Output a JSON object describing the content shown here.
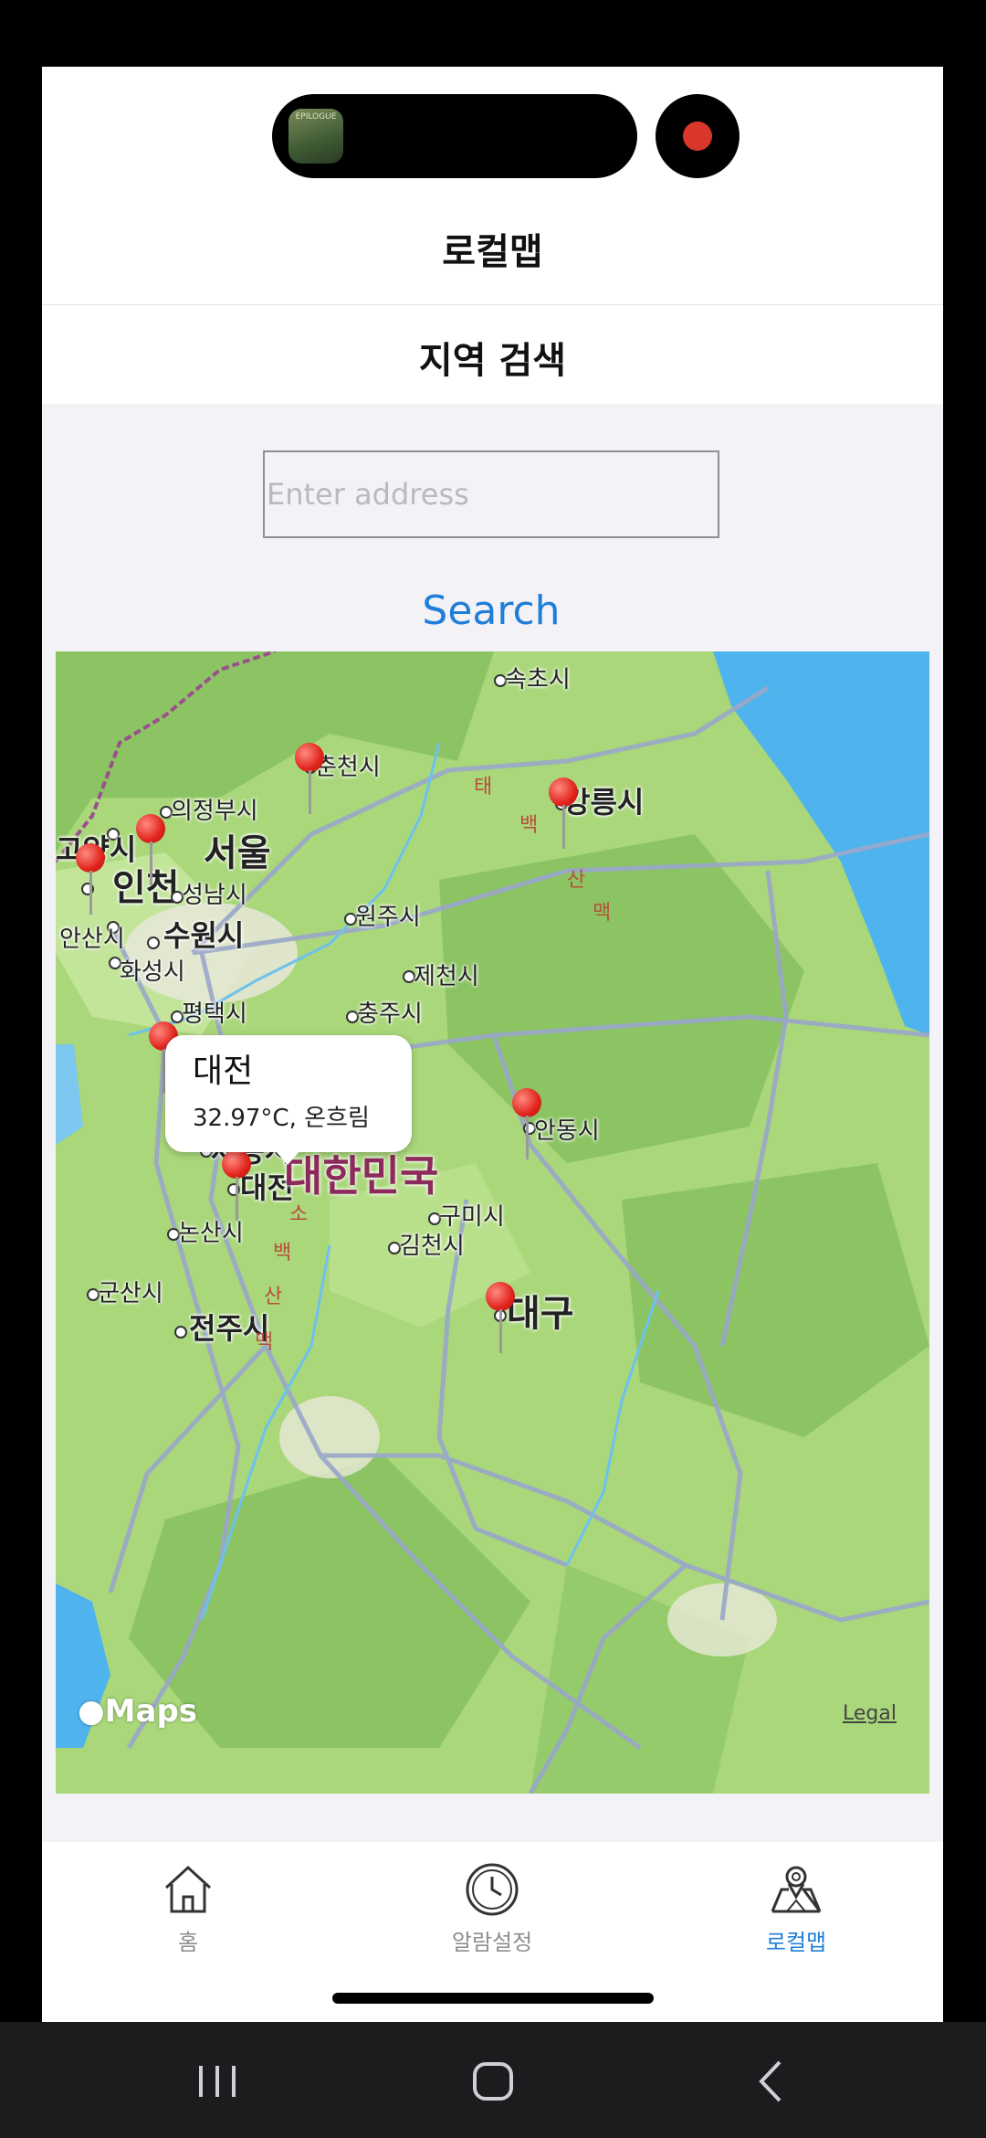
{
  "app": {
    "nav_title": "로컬맵",
    "section_title": "지역 검색",
    "island_thumb_label": "EPILOGUE"
  },
  "search": {
    "placeholder": "Enter address",
    "value": "",
    "button_label": "Search"
  },
  "map": {
    "country_label": "대한민국",
    "cities": [
      {
        "name": "속초시"
      },
      {
        "name": "춘천시"
      },
      {
        "name": "강릉시"
      },
      {
        "name": "의정부시"
      },
      {
        "name": "고양시"
      },
      {
        "name": "서울"
      },
      {
        "name": "인천"
      },
      {
        "name": "성남시"
      },
      {
        "name": "원주시"
      },
      {
        "name": "안산시"
      },
      {
        "name": "수원시"
      },
      {
        "name": "화성시"
      },
      {
        "name": "제천시"
      },
      {
        "name": "평택시"
      },
      {
        "name": "충주시"
      },
      {
        "name": "안동시"
      },
      {
        "name": "세종시"
      },
      {
        "name": "대전"
      },
      {
        "name": "구미시"
      },
      {
        "name": "논산시"
      },
      {
        "name": "김천시"
      },
      {
        "name": "군산시"
      },
      {
        "name": "대구"
      },
      {
        "name": "전주시"
      }
    ],
    "ranges": [
      "태",
      "백",
      "산",
      "맥",
      "소",
      "백",
      "산",
      "맥"
    ],
    "callout": {
      "title": "대전",
      "subtitle": "32.97°C, 온흐림"
    },
    "attribution": "Maps",
    "legal": "Legal",
    "colors": {
      "land": "#a9d77a",
      "sea": "#4fb3ee",
      "pin": "#e0231b"
    }
  },
  "tabs": [
    {
      "label": "홈",
      "icon": "house-icon",
      "active": false
    },
    {
      "label": "알람설정",
      "icon": "clock-icon",
      "active": false
    },
    {
      "label": "로컬맵",
      "icon": "map-pin-icon",
      "active": true
    }
  ],
  "accent_color": "#1f7ed8"
}
